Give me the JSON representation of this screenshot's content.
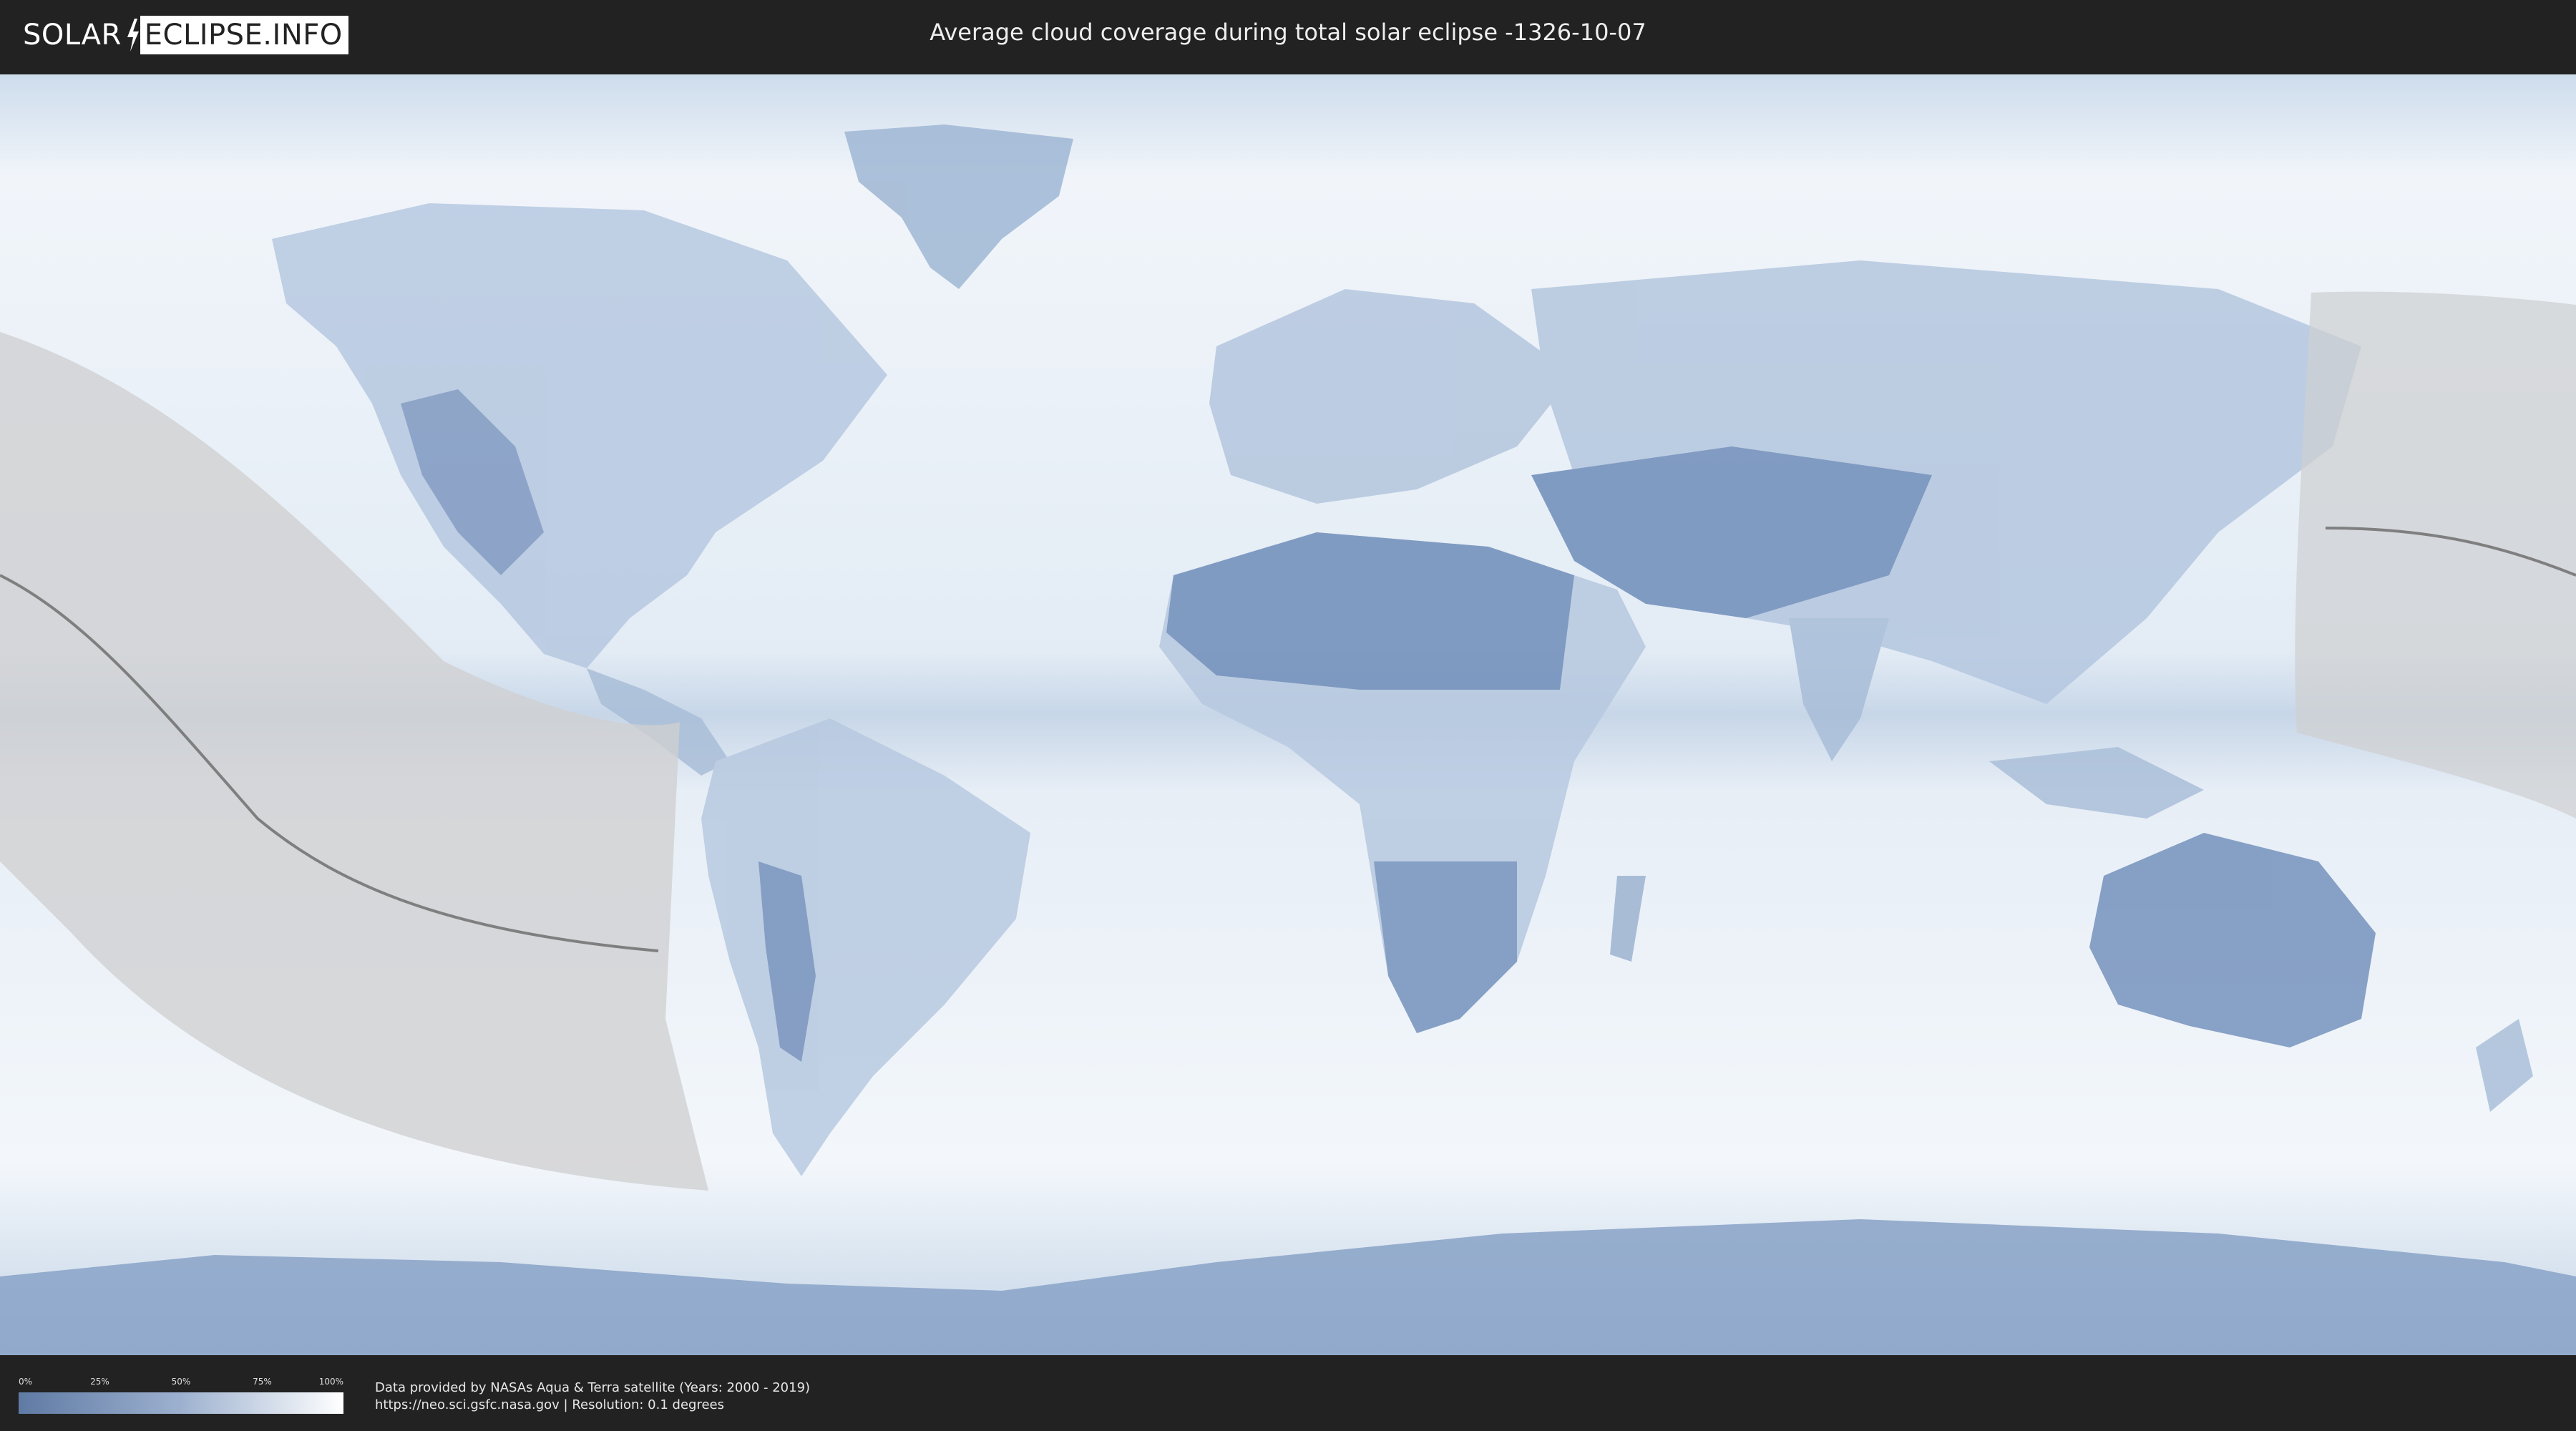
{
  "header": {
    "logo_left": "SOLAR",
    "logo_right": "ECLIPSE.INFO",
    "title": "Average cloud coverage during total solar eclipse -1326-10-07"
  },
  "map": {
    "background_color": "#eaf1f8",
    "land_color": "#6f8db9",
    "eclipse_zone_color": "#cfd0d1",
    "central_line_color": "#707070"
  },
  "legend": {
    "ticks": [
      "0%",
      "25%",
      "50%",
      "75%",
      "100%"
    ],
    "gradient_start": "#5f7aa4",
    "gradient_end": "#ffffff"
  },
  "footer": {
    "line1": "Data provided by NASAs Aqua & Terra satellite (Years: 2000 - 2019)",
    "line2": "https://neo.sci.gsfc.nasa.gov | Resolution: 0.1 degrees"
  }
}
